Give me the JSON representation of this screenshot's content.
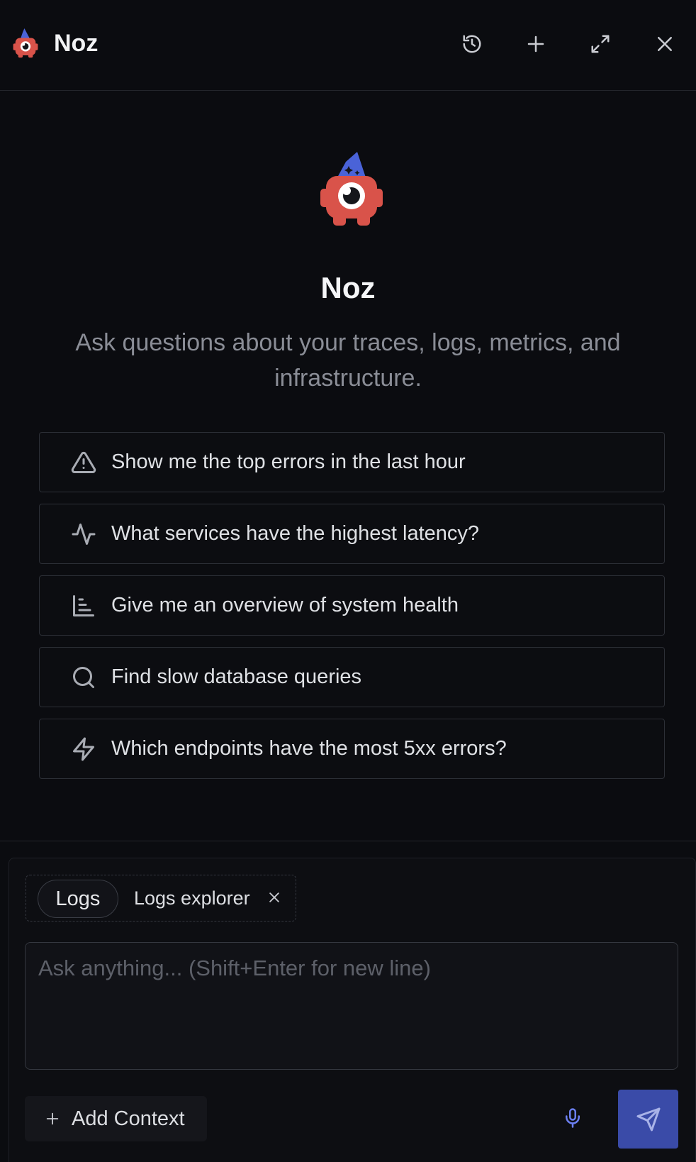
{
  "header": {
    "title": "Noz",
    "logo_icon": "noz-mascot-icon",
    "actions": [
      {
        "name": "history-button",
        "icon": "history-icon"
      },
      {
        "name": "new-chat-button",
        "icon": "plus-icon"
      },
      {
        "name": "expand-button",
        "icon": "maximize-icon"
      },
      {
        "name": "close-button",
        "icon": "close-icon"
      }
    ]
  },
  "hero": {
    "title": "Noz",
    "subtitle": "Ask questions about your traces, logs, metrics, and infrastructure."
  },
  "suggestions": [
    {
      "icon": "warning-triangle-icon",
      "label": "Show me the top errors in the last hour"
    },
    {
      "icon": "activity-icon",
      "label": "What services have the highest latency?"
    },
    {
      "icon": "bar-chart-icon",
      "label": "Give me an overview of system health"
    },
    {
      "icon": "search-icon",
      "label": "Find slow database queries"
    },
    {
      "icon": "zap-icon",
      "label": "Which endpoints have the most 5xx errors?"
    }
  ],
  "composer": {
    "context_chips": {
      "source": "Logs",
      "page": "Logs explorer"
    },
    "input": {
      "value": "",
      "placeholder": "Ask anything... (Shift+Enter for new line)"
    },
    "add_context_label": "Add Context",
    "mic_icon": "microphone-icon",
    "send_icon": "send-icon"
  },
  "colors": {
    "background": "#0b0c10",
    "mascot_red": "#d9534a",
    "hat_blue": "#4a63d8",
    "accent": "#3a4ba8",
    "mic": "#6b7ff0"
  }
}
